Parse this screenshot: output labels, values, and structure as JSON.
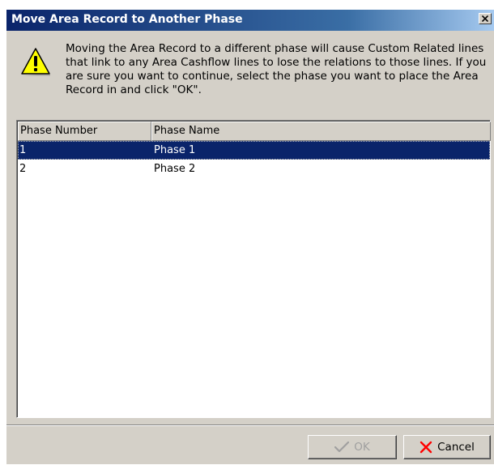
{
  "dialog": {
    "title": "Move Area Record to Another Phase",
    "close_glyph": "×",
    "icon": "warning-icon",
    "message": "Moving the Area Record to a different phase will cause Custom Related lines that link to any Area Cashflow lines to lose the relations to those lines. If you are sure you want to continue, select the phase you want to place the Area Record in and click \"OK\"."
  },
  "table": {
    "columns": [
      "Phase Number",
      "Phase Name"
    ],
    "rows": [
      {
        "number": "1",
        "name": "Phase 1",
        "selected": true
      },
      {
        "number": "2",
        "name": "Phase 2",
        "selected": false
      }
    ]
  },
  "buttons": {
    "ok_label": "OK",
    "ok_enabled": false,
    "cancel_label": "Cancel"
  },
  "colors": {
    "title_start": "#0a246a",
    "title_end": "#a6caf0",
    "selection": "#0a246a",
    "warning_yellow": "#ffff00",
    "cancel_x": "#ff0000"
  }
}
